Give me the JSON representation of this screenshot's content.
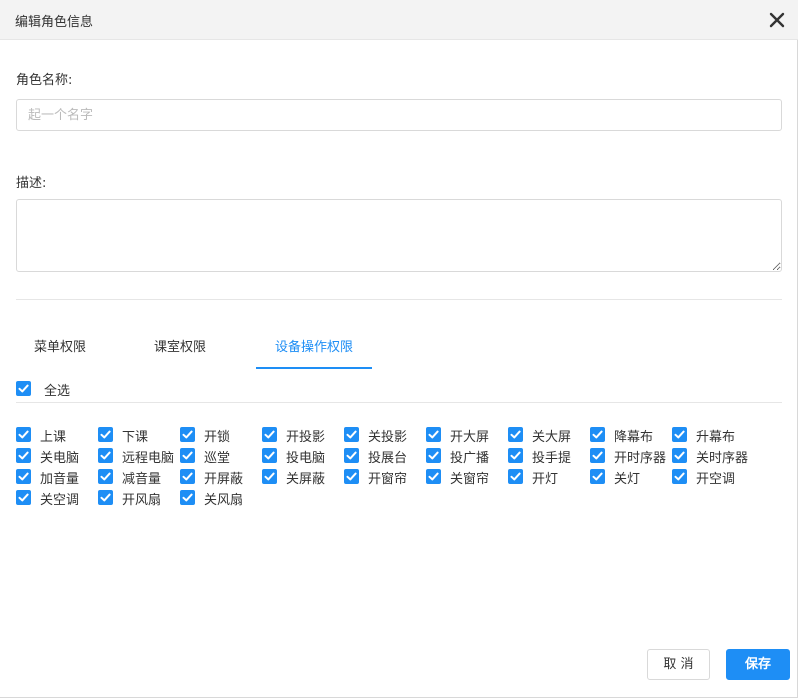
{
  "dialog": {
    "title": "编辑角色信息"
  },
  "form": {
    "role_name_label": "角色名称:",
    "role_name_placeholder": "起一个名字",
    "role_name_value": "",
    "description_label": "描述:",
    "description_value": ""
  },
  "tabs": [
    {
      "label": "菜单权限",
      "active": false
    },
    {
      "label": "课室权限",
      "active": false
    },
    {
      "label": "设备操作权限",
      "active": true
    }
  ],
  "select_all": {
    "label": "全选",
    "checked": true
  },
  "permissions": [
    [
      "上课",
      "下课",
      "开锁",
      "开投影",
      "关投影",
      "开大屏",
      "关大屏",
      "降幕布",
      "升幕布"
    ],
    [
      "关电脑",
      "远程电脑",
      "巡堂",
      "投电脑",
      "投展台",
      "投广播",
      "投手提",
      "开时序器",
      "关时序器"
    ],
    [
      "加音量",
      "减音量",
      "开屏蔽",
      "关屏蔽",
      "开窗帘",
      "关窗帘",
      "开灯",
      "关灯",
      "开空调"
    ],
    [
      "关空调",
      "开风扇",
      "关风扇"
    ]
  ],
  "buttons": {
    "cancel": "取 消",
    "save": "保存"
  },
  "colors": {
    "accent": "#1e8ef5"
  }
}
